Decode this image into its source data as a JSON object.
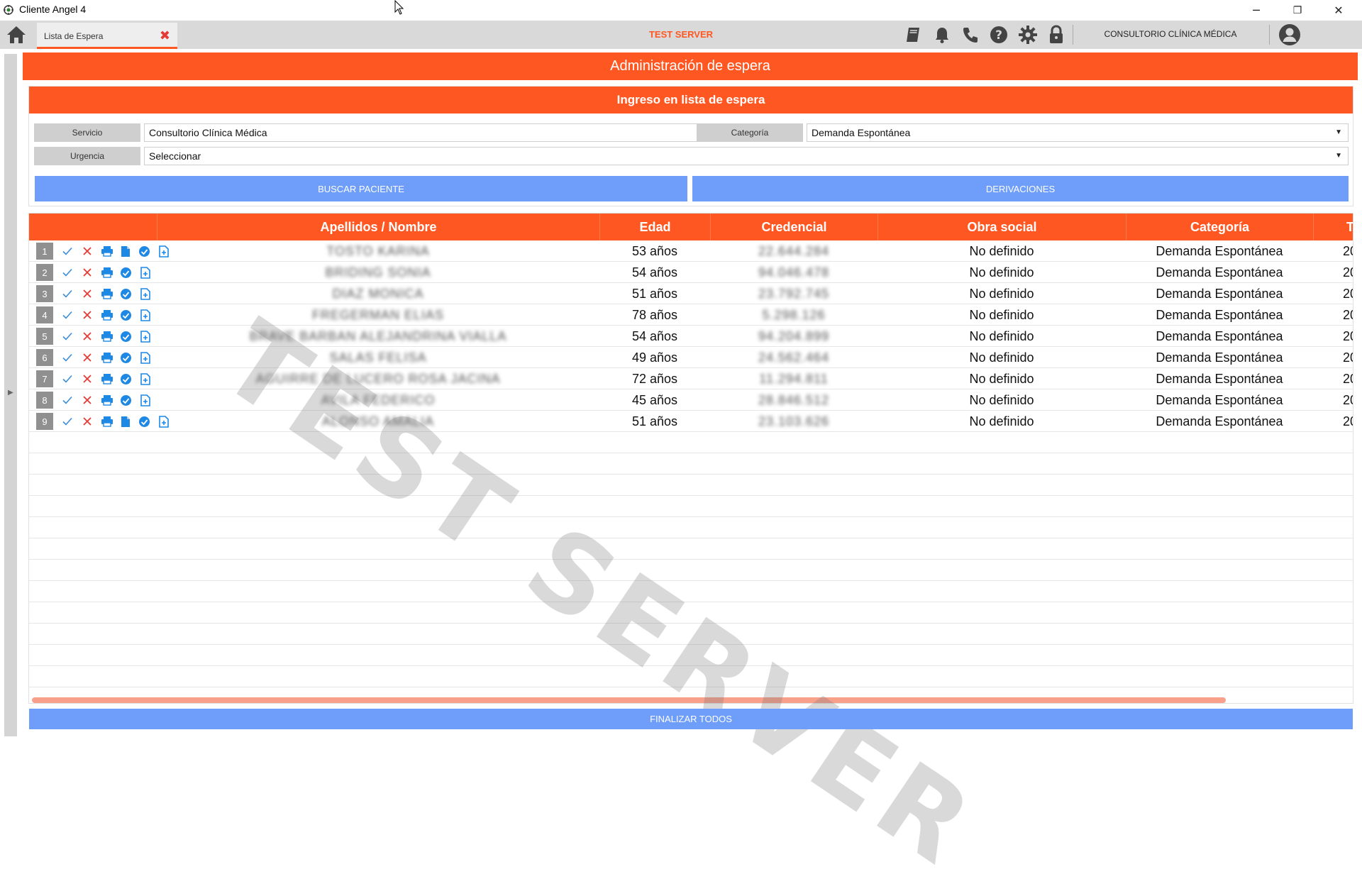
{
  "window": {
    "title": "Cliente Angel 4",
    "minimize": "─",
    "maximize": "❐",
    "close": "✕"
  },
  "toolbar": {
    "tab_label": "Lista de Espera",
    "tab_close": "✖",
    "server": "TEST SERVER",
    "clinic": "CONSULTORIO CLÍNICA MÉDICA",
    "icons": [
      "home-icon",
      "book-icon",
      "bell-icon",
      "phone-icon",
      "help-icon",
      "gear-icon",
      "lock-icon",
      "user-icon"
    ]
  },
  "main": {
    "banner": "Administración de espera",
    "form": {
      "header": "Ingreso en lista de espera",
      "servicio_label": "Servicio",
      "servicio_value": "Consultorio Clínica Médica",
      "categoria_label": "Categoría",
      "categoria_value": "Demanda Espontánea",
      "urgencia_label": "Urgencia",
      "urgencia_value": "Seleccionar",
      "buscar_button": "BUSCAR PACIENTE",
      "derivaciones_button": "DERIVACIONES"
    },
    "grid": {
      "columns": [
        "Apellidos / Nombre",
        "Edad",
        "Credencial",
        "Obra social",
        "Categoría",
        "T"
      ],
      "rows": [
        {
          "num": "1",
          "nombre": "TOSTO KARINA",
          "edad": "53 años",
          "credencial": "22.644.284",
          "obra": "No definido",
          "categoria": "Demanda Espontánea",
          "t": "20",
          "doc": true
        },
        {
          "num": "2",
          "nombre": "BRIDING SONIA",
          "edad": "54 años",
          "credencial": "94.046.478",
          "obra": "No definido",
          "categoria": "Demanda Espontánea",
          "t": "20",
          "doc": false
        },
        {
          "num": "3",
          "nombre": "DIAZ MONICA",
          "edad": "51 años",
          "credencial": "23.792.745",
          "obra": "No definido",
          "categoria": "Demanda Espontánea",
          "t": "20",
          "doc": false
        },
        {
          "num": "4",
          "nombre": "FREGERMAN ELIAS",
          "edad": "78 años",
          "credencial": "5.298.126",
          "obra": "No definido",
          "categoria": "Demanda Espontánea",
          "t": "20",
          "doc": false
        },
        {
          "num": "5",
          "nombre": "BRAVE BARBAN ALEJANDRINA VIALLA",
          "edad": "54 años",
          "credencial": "94.204.899",
          "obra": "No definido",
          "categoria": "Demanda Espontánea",
          "t": "20",
          "doc": false
        },
        {
          "num": "6",
          "nombre": "SALAS FELISA",
          "edad": "49 años",
          "credencial": "24.562.464",
          "obra": "No definido",
          "categoria": "Demanda Espontánea",
          "t": "20",
          "doc": false
        },
        {
          "num": "7",
          "nombre": "AGUIRRE DE LUCERO ROSA JACINA",
          "edad": "72 años",
          "credencial": "11.294.811",
          "obra": "No definido",
          "categoria": "Demanda Espontánea",
          "t": "20",
          "doc": false
        },
        {
          "num": "8",
          "nombre": "AVILA FEDERICO",
          "edad": "45 años",
          "credencial": "28.846.512",
          "obra": "No definido",
          "categoria": "Demanda Espontánea",
          "t": "20",
          "doc": false
        },
        {
          "num": "9",
          "nombre": "ALONSO AMALIA",
          "edad": "51 años",
          "credencial": "23.103.626",
          "obra": "No definido",
          "categoria": "Demanda Espontánea",
          "t": "20",
          "doc": true
        }
      ]
    },
    "watermark": "TEST SERVER",
    "finalizar_button": "FINALIZAR TODOS"
  },
  "colors": {
    "accent": "#ff5722",
    "button_blue": "#6e9ef9",
    "icon_blue": "#1e88e5",
    "check_blue": "#3a8fd8",
    "cross_red": "#e53935"
  }
}
